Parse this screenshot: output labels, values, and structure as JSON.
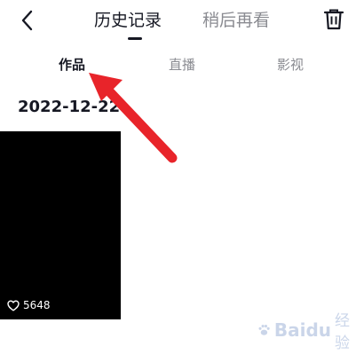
{
  "header": {
    "tabs": [
      {
        "label": "历史记录",
        "active": true
      },
      {
        "label": "稍后再看",
        "active": false
      }
    ]
  },
  "subtabs": [
    {
      "label": "作品",
      "active": true
    },
    {
      "label": "直播",
      "active": false
    },
    {
      "label": "影视",
      "active": false
    }
  ],
  "history": {
    "date": "2022-12-22",
    "items": [
      {
        "likes": "5648"
      }
    ]
  },
  "watermark": {
    "brand": "Baidu",
    "suffix": "经验"
  },
  "colors": {
    "primary_text": "#161823",
    "secondary_text": "#8a8b91",
    "annotation_arrow": "#e8242a"
  }
}
